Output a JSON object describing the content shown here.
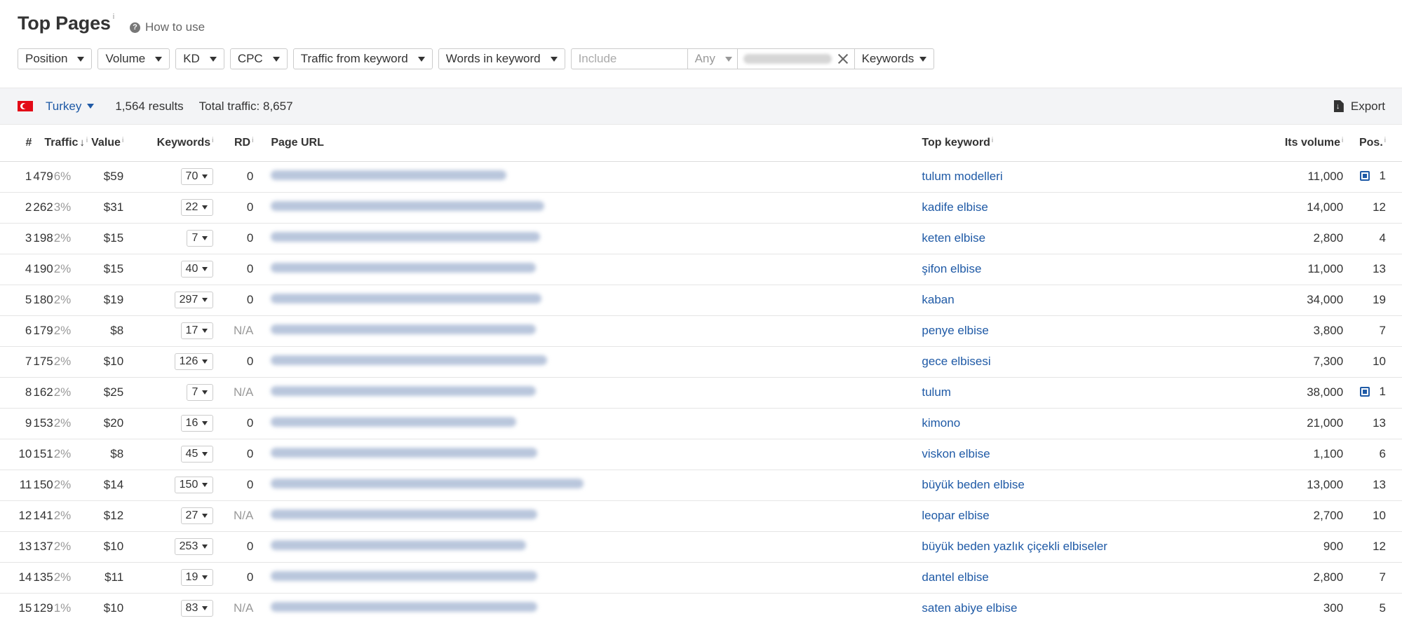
{
  "header": {
    "title": "Top Pages",
    "title_info": "i",
    "how_to_use": "How to use"
  },
  "filters": {
    "position": "Position",
    "volume": "Volume",
    "kd": "KD",
    "cpc": "CPC",
    "traffic_from_keyword": "Traffic from keyword",
    "words_in_keyword": "Words in keyword",
    "include_placeholder": "Include",
    "any": "Any",
    "keywords": "Keywords"
  },
  "bar": {
    "country": "Turkey",
    "results": "1,564 results",
    "total_traffic": "Total traffic: 8,657",
    "export": "Export"
  },
  "columns": {
    "num": "#",
    "traffic": "Traffic",
    "value": "Value",
    "keywords": "Keywords",
    "rd": "RD",
    "page_url": "Page URL",
    "top_keyword": "Top keyword",
    "its_volume": "Its volume",
    "pos": "Pos.",
    "info": "i"
  },
  "rows": [
    {
      "num": "1",
      "traffic": "479",
      "pct": "6%",
      "value": "$59",
      "keywords": "70",
      "rd": "0",
      "top_keyword": "tulum modelleri",
      "volume": "11,000",
      "pos": "1",
      "serp_feature": true
    },
    {
      "num": "2",
      "traffic": "262",
      "pct": "3%",
      "value": "$31",
      "keywords": "22",
      "rd": "0",
      "top_keyword": "kadife elbise",
      "volume": "14,000",
      "pos": "12",
      "serp_feature": false
    },
    {
      "num": "3",
      "traffic": "198",
      "pct": "2%",
      "value": "$15",
      "keywords": "7",
      "rd": "0",
      "top_keyword": "keten elbise",
      "volume": "2,800",
      "pos": "4",
      "serp_feature": false
    },
    {
      "num": "4",
      "traffic": "190",
      "pct": "2%",
      "value": "$15",
      "keywords": "40",
      "rd": "0",
      "top_keyword": "şifon elbise",
      "volume": "11,000",
      "pos": "13",
      "serp_feature": false
    },
    {
      "num": "5",
      "traffic": "180",
      "pct": "2%",
      "value": "$19",
      "keywords": "297",
      "rd": "0",
      "top_keyword": "kaban",
      "volume": "34,000",
      "pos": "19",
      "serp_feature": false
    },
    {
      "num": "6",
      "traffic": "179",
      "pct": "2%",
      "value": "$8",
      "keywords": "17",
      "rd": "N/A",
      "top_keyword": "penye elbise",
      "volume": "3,800",
      "pos": "7",
      "serp_feature": false
    },
    {
      "num": "7",
      "traffic": "175",
      "pct": "2%",
      "value": "$10",
      "keywords": "126",
      "rd": "0",
      "top_keyword": "gece elbisesi",
      "volume": "7,300",
      "pos": "10",
      "serp_feature": false
    },
    {
      "num": "8",
      "traffic": "162",
      "pct": "2%",
      "value": "$25",
      "keywords": "7",
      "rd": "N/A",
      "top_keyword": "tulum",
      "volume": "38,000",
      "pos": "1",
      "serp_feature": true
    },
    {
      "num": "9",
      "traffic": "153",
      "pct": "2%",
      "value": "$20",
      "keywords": "16",
      "rd": "0",
      "top_keyword": "kimono",
      "volume": "21,000",
      "pos": "13",
      "serp_feature": false
    },
    {
      "num": "10",
      "traffic": "151",
      "pct": "2%",
      "value": "$8",
      "keywords": "45",
      "rd": "0",
      "top_keyword": "viskon elbise",
      "volume": "1,100",
      "pos": "6",
      "serp_feature": false
    },
    {
      "num": "11",
      "traffic": "150",
      "pct": "2%",
      "value": "$14",
      "keywords": "150",
      "rd": "0",
      "top_keyword": "büyük beden elbise",
      "volume": "13,000",
      "pos": "13",
      "serp_feature": false
    },
    {
      "num": "12",
      "traffic": "141",
      "pct": "2%",
      "value": "$12",
      "keywords": "27",
      "rd": "N/A",
      "top_keyword": "leopar elbise",
      "volume": "2,700",
      "pos": "10",
      "serp_feature": false
    },
    {
      "num": "13",
      "traffic": "137",
      "pct": "2%",
      "value": "$10",
      "keywords": "253",
      "rd": "0",
      "top_keyword": "büyük beden yazlık çiçekli elbiseler",
      "volume": "900",
      "pos": "12",
      "serp_feature": false
    },
    {
      "num": "14",
      "traffic": "135",
      "pct": "2%",
      "value": "$11",
      "keywords": "19",
      "rd": "0",
      "top_keyword": "dantel elbise",
      "volume": "2,800",
      "pos": "7",
      "serp_feature": false
    },
    {
      "num": "15",
      "traffic": "129",
      "pct": "1%",
      "value": "$10",
      "keywords": "83",
      "rd": "N/A",
      "top_keyword": "saten abiye elbise",
      "volume": "300",
      "pos": "5",
      "serp_feature": false
    }
  ],
  "colors": {
    "link": "#1f5aa6",
    "muted": "#999999",
    "bar_bg": "#f3f4f6",
    "flag_red": "#e30a17"
  }
}
